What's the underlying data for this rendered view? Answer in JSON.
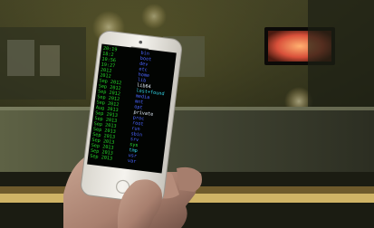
{
  "image": {
    "description_colors": {
      "background_dark": "#2a2b18",
      "bar_light": "#f0cf76",
      "tv_glow": "#d9503a",
      "terminal_green": "#25d428",
      "terminal_blue": "#4b64ff",
      "terminal_cyan": "#33d6e8",
      "phone_body": "#f1efe9"
    }
  },
  "phone": {
    "terminal_lines": [
      {
        "date": "20:19",
        "name": "bin",
        "color": "blue"
      },
      {
        "date": "18:2",
        "name": "boot",
        "color": "blue"
      },
      {
        "date": "10:56",
        "name": "dev",
        "color": "blue"
      },
      {
        "date": "19:27",
        "name": "etc",
        "color": "blue"
      },
      {
        "date": "2012",
        "name": "home",
        "color": "blue"
      },
      {
        "date": "2012",
        "name": "lib",
        "color": "blue"
      },
      {
        "date": "Sep 2012",
        "name": "lib64",
        "color": "white"
      },
      {
        "date": "Sep 2012",
        "name": "lost+found",
        "color": "cyan"
      },
      {
        "date": "Sep 2012",
        "name": "media",
        "color": "blue"
      },
      {
        "date": "Sep 2012",
        "name": "mnt",
        "color": "blue"
      },
      {
        "date": "Sep 2012",
        "name": "opt",
        "color": "blue"
      },
      {
        "date": "Aug 2013",
        "name": "private",
        "color": "white"
      },
      {
        "date": "Sep 2013",
        "name": "proc",
        "color": "blue"
      },
      {
        "date": "Sep 2013",
        "name": "root",
        "color": "blue"
      },
      {
        "date": "Sep 2013",
        "name": "run",
        "color": "blue"
      },
      {
        "date": "Sep 2013",
        "name": "sbin",
        "color": "blue"
      },
      {
        "date": "Sep 2013",
        "name": "srv",
        "color": "blue"
      },
      {
        "date": "Sep 2013",
        "name": "sys",
        "color": "green"
      },
      {
        "date": "Sep 2013",
        "name": "tmp",
        "color": "cyan"
      },
      {
        "date": "Sep 2013",
        "name": "usr",
        "color": "blue"
      },
      {
        "date": "Sep 2013",
        "name": "var",
        "color": "blue"
      }
    ]
  }
}
